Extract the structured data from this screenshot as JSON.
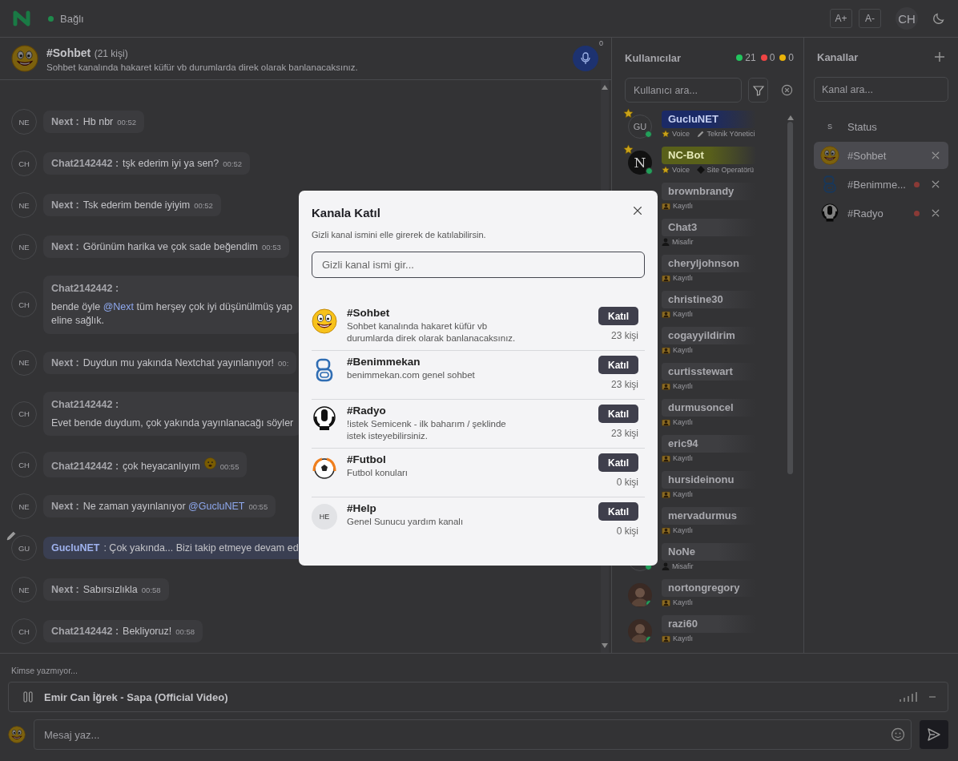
{
  "topbar": {
    "status": "Bağlı",
    "connected": true,
    "font_buttons": [
      "A+",
      "A-"
    ],
    "user_initials": "CH"
  },
  "chat_header": {
    "channel": "#Sohbet",
    "member_count": "(21 kişi)",
    "topic": "Sohbet kanalında hakaret küfür vb durumlarda direk olarak banlanacaksınız.",
    "mic_badge": "0"
  },
  "messages": [
    {
      "initials": "NE",
      "author": "Next :",
      "kind": "inline",
      "highlight": false,
      "parts": [
        {
          "kind": "text",
          "text": "Hb nbr"
        }
      ],
      "time": "00:52"
    },
    {
      "initials": "CH",
      "author": "Chat2142442 :",
      "kind": "inline",
      "highlight": false,
      "parts": [
        {
          "kind": "text",
          "text": "tşk ederim iyi ya sen?"
        }
      ],
      "time": "00:52"
    },
    {
      "initials": "NE",
      "author": "Next :",
      "kind": "inline",
      "highlight": false,
      "parts": [
        {
          "kind": "text",
          "text": "Tsk ederim bende iyiyim"
        }
      ],
      "time": "00:52"
    },
    {
      "initials": "NE",
      "author": "Next :",
      "kind": "inline",
      "highlight": false,
      "parts": [
        {
          "kind": "text",
          "text": "Görünüm harika ve çok sade beğendim"
        }
      ],
      "time": "00:53"
    },
    {
      "initials": "CH",
      "author": "Chat2142442 :",
      "kind": "block",
      "highlight": false,
      "parts": [
        {
          "kind": "text",
          "text": "bende öyle "
        },
        {
          "kind": "mention",
          "text": "@Next"
        },
        {
          "kind": "text",
          "text": " tüm herşey çok iyi düşünülmüş yap"
        },
        {
          "kind": "break"
        },
        {
          "kind": "text",
          "text": "eline sağlık."
        }
      ]
    },
    {
      "initials": "NE",
      "author": "Next :",
      "kind": "inline",
      "highlight": false,
      "parts": [
        {
          "kind": "text",
          "text": "Duydun mu yakında Nextchat yayınlanıyor!"
        }
      ],
      "time": "00:"
    },
    {
      "initials": "CH",
      "author": "Chat2142442 :",
      "kind": "block",
      "highlight": false,
      "parts": [
        {
          "kind": "text",
          "text": "Evet bende duydum, çok yakında yayınlanacağı söyler"
        }
      ]
    },
    {
      "initials": "CH",
      "author": "Chat2142442 :",
      "kind": "inline",
      "highlight": false,
      "parts": [
        {
          "kind": "text",
          "text": "çok heyacanlıyım"
        },
        {
          "kind": "emoji"
        }
      ],
      "time": "00:55"
    },
    {
      "initials": "NE",
      "author": "Next :",
      "kind": "inline",
      "highlight": false,
      "parts": [
        {
          "kind": "text",
          "text": "Ne zaman yayınlanıyor "
        },
        {
          "kind": "mention",
          "text": "@GucluNET"
        }
      ],
      "time": "00:55"
    },
    {
      "initials": "GU",
      "author": "GucluNET",
      "kind": "inline",
      "highlight": true,
      "editor": true,
      "parts": [
        {
          "kind": "text",
          "text": ": Çok yakında... Bizi takip etmeye devam ed"
        }
      ]
    },
    {
      "initials": "NE",
      "author": "Next :",
      "kind": "inline",
      "highlight": false,
      "parts": [
        {
          "kind": "text",
          "text": "Sabırsızlıkla"
        }
      ],
      "time": "00:58"
    },
    {
      "initials": "CH",
      "author": "Chat2142442 :",
      "kind": "inline",
      "highlight": false,
      "parts": [
        {
          "kind": "text",
          "text": "Bekliyoruz!"
        }
      ],
      "time": "00:58"
    }
  ],
  "users_panel": {
    "title": "Kullanıcılar",
    "counts": [
      {
        "value": "21",
        "color": "#22c55e"
      },
      {
        "value": "0",
        "color": "#ef4444"
      },
      {
        "value": "0",
        "color": "#eab308"
      }
    ],
    "search_placeholder": "Kullanıcı ara...",
    "users": [
      {
        "name": "GucluNET",
        "kind": "admin",
        "avatar": {
          "kind": "initials",
          "initials": "GU"
        },
        "starred": true,
        "online": true,
        "tags": [
          {
            "kind": "star",
            "text": "Voice"
          },
          {
            "kind": "pencil",
            "text": "Teknik Yönetici"
          }
        ]
      },
      {
        "name": "NC-Bot",
        "kind": "bot",
        "avatar": {
          "kind": "bot",
          "initials": "N"
        },
        "starred": true,
        "online": true,
        "tags": [
          {
            "kind": "star",
            "text": "Voice"
          },
          {
            "kind": "diamond",
            "text": "Site Operatörü"
          }
        ]
      },
      {
        "name": "brownbrandy",
        "kind": "member",
        "starred": false,
        "tags": [
          {
            "kind": "card",
            "text": "Kayıtlı"
          }
        ]
      },
      {
        "name": "Chat3",
        "kind": "member",
        "starred": false,
        "tags": [
          {
            "kind": "person",
            "text": "Misafir"
          }
        ]
      },
      {
        "name": "cheryljohnson",
        "kind": "member",
        "starred": false,
        "tags": [
          {
            "kind": "card",
            "text": "Kayıtlı"
          }
        ]
      },
      {
        "name": "christine30",
        "kind": "member",
        "starred": false,
        "tags": [
          {
            "kind": "card",
            "text": "Kayıtlı"
          }
        ]
      },
      {
        "name": "cogayyildirim",
        "kind": "member",
        "starred": false,
        "tags": [
          {
            "kind": "card",
            "text": "Kayıtlı"
          }
        ]
      },
      {
        "name": "curtisstewart",
        "kind": "member",
        "starred": false,
        "tags": [
          {
            "kind": "card",
            "text": "Kayıtlı"
          }
        ]
      },
      {
        "name": "durmusoncel",
        "kind": "member",
        "starred": false,
        "tags": [
          {
            "kind": "card",
            "text": "Kayıtlı"
          }
        ]
      },
      {
        "name": "eric94",
        "kind": "member",
        "starred": false,
        "tags": [
          {
            "kind": "card",
            "text": "Kayıtlı"
          }
        ]
      },
      {
        "name": "hursideinonu",
        "kind": "member",
        "starred": false,
        "tags": [
          {
            "kind": "card",
            "text": "Kayıtlı"
          }
        ]
      },
      {
        "name": "mervadurmus",
        "kind": "member",
        "starred": false,
        "tags": [
          {
            "kind": "card",
            "text": "Kayıtlı"
          }
        ]
      },
      {
        "name": "NoNe",
        "kind": "member",
        "avatar": {
          "kind": "plain"
        },
        "starred": false,
        "online": true,
        "tags": [
          {
            "kind": "person",
            "text": "Misafir"
          }
        ]
      },
      {
        "name": "nortongregory",
        "kind": "member",
        "avatar": {
          "kind": "photo"
        },
        "starred": false,
        "online": true,
        "tags": [
          {
            "kind": "card",
            "text": "Kayıtlı"
          }
        ]
      },
      {
        "name": "razi60",
        "kind": "member",
        "avatar": {
          "kind": "photo"
        },
        "starred": false,
        "online": true,
        "tags": [
          {
            "kind": "card",
            "text": "Kayıtlı"
          }
        ]
      }
    ]
  },
  "channels_panel": {
    "title": "Kanallar",
    "search_placeholder": "Kanal ara...",
    "items": [
      {
        "kind": "status",
        "initial": "S",
        "name": "Status",
        "selected": false,
        "unread": false,
        "closable": false
      },
      {
        "kind": "emoji",
        "name": "#Sohbet",
        "selected": true,
        "unread": false,
        "closable": true
      },
      {
        "kind": "logo",
        "name": "#Benimme...",
        "selected": false,
        "unread": true,
        "closable": true
      },
      {
        "kind": "radio",
        "name": "#Radyo",
        "selected": false,
        "unread": true,
        "closable": true
      }
    ]
  },
  "typing_status": "Kimse yazmıyor...",
  "player": {
    "title": "Emir Can İğrek - Sapa (Official Video)",
    "playing": true
  },
  "composer": {
    "placeholder": "Mesaj yaz..."
  },
  "join_modal": {
    "title": "Kanala Katıl",
    "subtitle": "Gizli kanal ismini elle girerek de katılabilirsin.",
    "input_placeholder": "Gizli kanal ismi gir...",
    "channels": [
      {
        "kind": "emoji",
        "name": "#Sohbet",
        "description": "Sohbet kanalında hakaret küfür vb durumlarda direk olarak banlanacaksınız.",
        "button": "Katıl",
        "count": "23 kişi"
      },
      {
        "kind": "logo",
        "name": "#Benimmekan",
        "description": "benimmekan.com genel sohbet",
        "button": "Katıl",
        "count": "23 kişi"
      },
      {
        "kind": "radio",
        "name": "#Radyo",
        "description": "!istek Semicenk - ilk baharım / şeklinde istek isteyebilirsiniz.",
        "button": "Katıl",
        "count": "23 kişi"
      },
      {
        "kind": "ball",
        "name": "#Futbol",
        "description": "Futbol konuları",
        "button": "Katıl",
        "count": "0 kişi"
      },
      {
        "kind": "initials",
        "initials": "HE",
        "name": "#Help",
        "description": "Genel Sunucu yardım kanalı",
        "button": "Katıl",
        "count": "0 kişi"
      }
    ]
  }
}
